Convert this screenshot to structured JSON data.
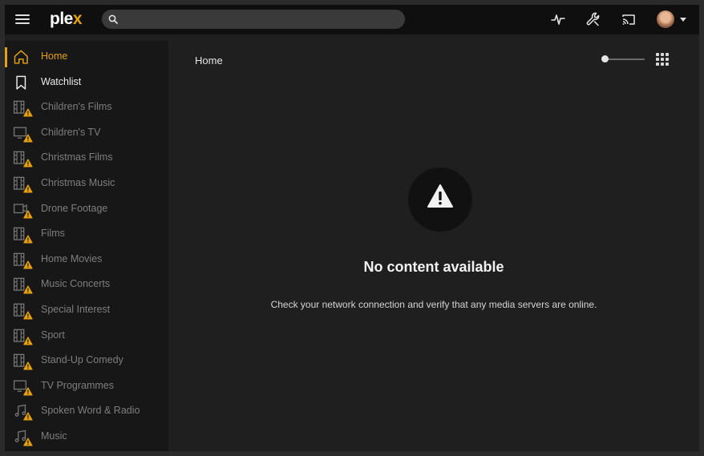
{
  "app": {
    "logo_main": "ple",
    "logo_x": "x"
  },
  "search": {
    "value": "",
    "placeholder": ""
  },
  "toolbar": {
    "icons": [
      "activity-icon",
      "settings-wrench-icon",
      "cast-icon"
    ]
  },
  "sidebar": {
    "items": [
      {
        "label": "Home",
        "icon": "home-icon",
        "state": "active"
      },
      {
        "label": "Watchlist",
        "icon": "bookmark-icon",
        "state": "normal"
      },
      {
        "label": "Children's Films",
        "icon": "film-icon",
        "state": "warning"
      },
      {
        "label": "Children's TV",
        "icon": "tv-icon",
        "state": "warning"
      },
      {
        "label": "Christmas Films",
        "icon": "film-icon",
        "state": "warning"
      },
      {
        "label": "Christmas Music",
        "icon": "film-icon",
        "state": "warning"
      },
      {
        "label": "Drone Footage",
        "icon": "video-icon",
        "state": "warning"
      },
      {
        "label": "Films",
        "icon": "film-icon",
        "state": "warning"
      },
      {
        "label": "Home Movies",
        "icon": "film-icon",
        "state": "warning"
      },
      {
        "label": "Music Concerts",
        "icon": "film-icon",
        "state": "warning"
      },
      {
        "label": "Special Interest",
        "icon": "film-icon",
        "state": "warning"
      },
      {
        "label": "Sport",
        "icon": "film-icon",
        "state": "warning"
      },
      {
        "label": "Stand-Up Comedy",
        "icon": "film-icon",
        "state": "warning"
      },
      {
        "label": "TV Programmes",
        "icon": "tv-icon",
        "state": "warning"
      },
      {
        "label": "Spoken Word & Radio",
        "icon": "music-icon",
        "state": "warning"
      },
      {
        "label": "Music",
        "icon": "music-icon",
        "state": "warning"
      }
    ]
  },
  "main": {
    "title": "Home",
    "empty_title": "No content available",
    "empty_description": "Check your network connection and verify that any media servers are online."
  },
  "colors": {
    "accent": "#e5a00d",
    "warning": "#e5a00d",
    "background": "#1f1f1f"
  }
}
